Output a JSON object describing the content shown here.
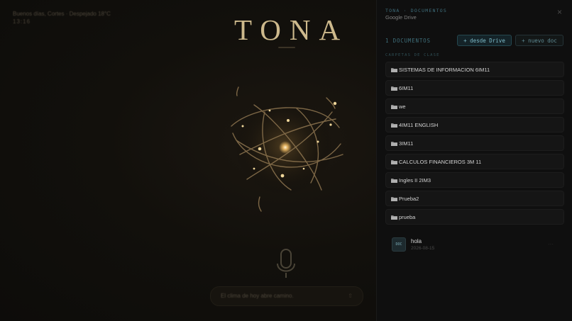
{
  "app": {
    "greeting": "Buenos días, Cortes · Despejado 18°C",
    "clock": "13:16",
    "brand": "TONA",
    "prompt_placeholder": "El clima de hoy abre camino.",
    "prompt_hint": "⇧"
  },
  "panel": {
    "title": "TONA · DOCUMENTOS",
    "subtitle": "Google Drive",
    "close_icon": "×",
    "count_label": "1 DOCUMENTOS",
    "btn_drive": "+ desde Drive",
    "btn_new": "+ nuevo doc",
    "section_label": "CARPETAS DE CLASE",
    "folders": [
      {
        "label": "SISTEMAS DE INFORMACION 6IM11"
      },
      {
        "label": "6IM11"
      },
      {
        "label": "we"
      },
      {
        "label": "4IM11 ENGLISH"
      },
      {
        "label": "3IM11"
      },
      {
        "label": "CALCULOS FINANCIEROS 3M 11"
      },
      {
        "label": "Ingles II 2IM3"
      },
      {
        "label": "Prueba2"
      },
      {
        "label": "prueba"
      }
    ],
    "document": {
      "badge": "DOC",
      "name": "hola",
      "date": "2026-08-15",
      "more_icon": "⋯"
    }
  },
  "colors": {
    "accent": "#3f6e7c",
    "brand_gold": "#cdb98c",
    "panel_bg": "#0f0f0f"
  },
  "icons": [
    "folder-icon",
    "close-icon",
    "microphone-icon",
    "more-icon"
  ]
}
